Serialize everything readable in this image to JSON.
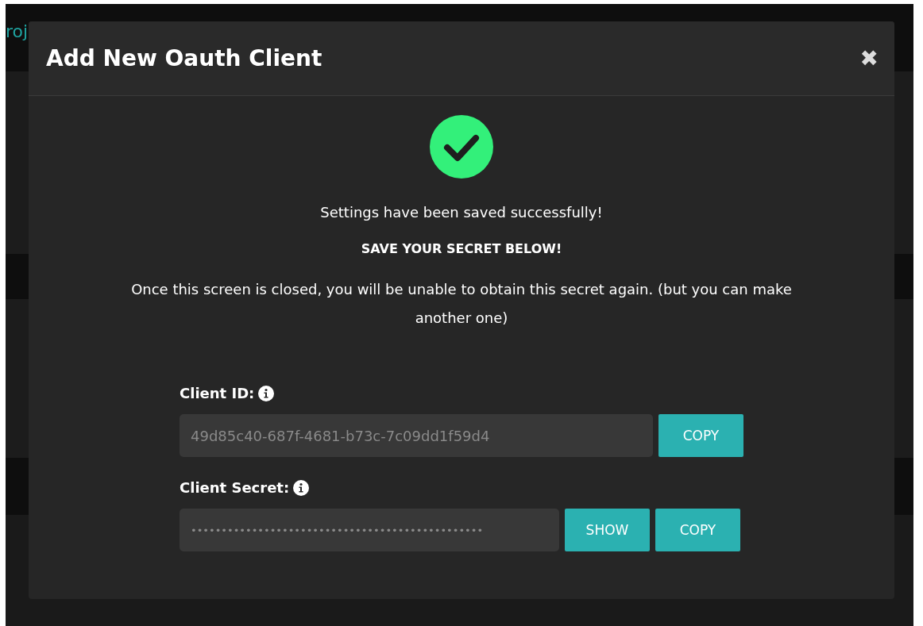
{
  "background": {
    "link_text": "roj"
  },
  "modal": {
    "title": "Add New Oauth Client",
    "close": "✖",
    "success_message": "Settings have been saved successfully!",
    "warning_heading": "SAVE YOUR SECRET BELOW!",
    "warning_text": "Once this screen is closed, you will be unable to obtain this secret again. (but you can make another one)",
    "fields": [
      {
        "kind": "id",
        "label": "Client ID:",
        "value": "49d85c40-687f-4681-b73c-7c09dd1f59d4",
        "buttons": [
          "COPY"
        ]
      },
      {
        "kind": "secret",
        "label": "Client Secret:",
        "value": "••••••••••••••••••••••••••••••••••••••••••••••••",
        "buttons": [
          "SHOW",
          "COPY"
        ]
      }
    ]
  }
}
